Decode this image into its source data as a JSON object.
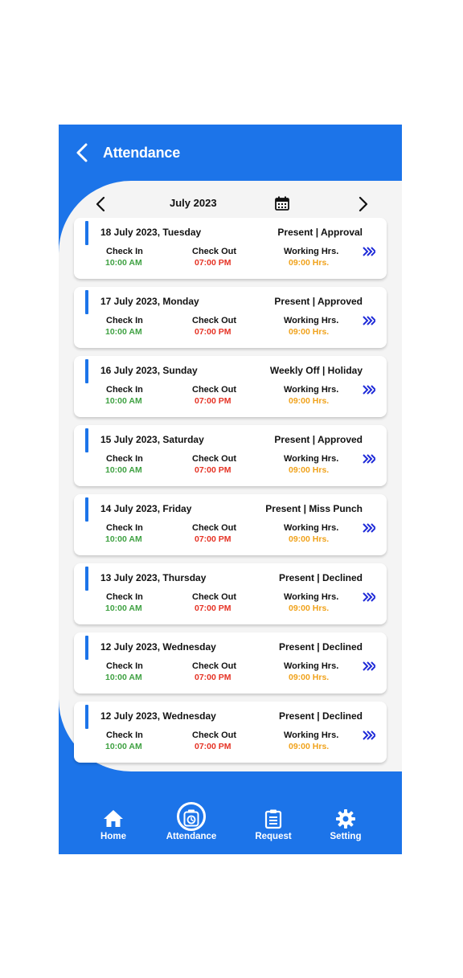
{
  "header": {
    "title": "Attendance"
  },
  "month_bar": {
    "label": "July 2023"
  },
  "columns": {
    "check_in": "Check In",
    "check_out": "Check Out",
    "working": "Working Hrs."
  },
  "records": [
    {
      "date": "18 July 2023, Tuesday",
      "status": "Present | Approval",
      "check_in": "10:00 AM",
      "check_out": "07:00 PM",
      "hours": "09:00 Hrs."
    },
    {
      "date": "17 July 2023, Monday",
      "status": "Present | Approved",
      "check_in": "10:00 AM",
      "check_out": "07:00 PM",
      "hours": "09:00 Hrs."
    },
    {
      "date": "16 July 2023, Sunday",
      "status": "Weekly Off | Holiday",
      "check_in": "10:00 AM",
      "check_out": "07:00 PM",
      "hours": "09:00 Hrs."
    },
    {
      "date": "15 July 2023, Saturday",
      "status": "Present | Approved",
      "check_in": "10:00 AM",
      "check_out": "07:00 PM",
      "hours": "09:00 Hrs."
    },
    {
      "date": "14 July 2023, Friday",
      "status": "Present | Miss Punch",
      "check_in": "10:00 AM",
      "check_out": "07:00 PM",
      "hours": "09:00 Hrs."
    },
    {
      "date": "13 July 2023, Thursday",
      "status": "Present | Declined",
      "check_in": "10:00 AM",
      "check_out": "07:00 PM",
      "hours": "09:00 Hrs."
    },
    {
      "date": "12 July 2023, Wednesday",
      "status": "Present | Declined",
      "check_in": "10:00 AM",
      "check_out": "07:00 PM",
      "hours": "09:00 Hrs."
    },
    {
      "date": "12 July 2023, Wednesday",
      "status": "Present | Declined",
      "check_in": "10:00 AM",
      "check_out": "07:00 PM",
      "hours": "09:00 Hrs."
    }
  ],
  "nav": {
    "home": "Home",
    "attendance": "Attendance",
    "request": "Request",
    "setting": "Setting"
  },
  "colors": {
    "primary": "#1c74e9",
    "check_in": "#3fa142",
    "check_out": "#e53224",
    "hours": "#f0a21b",
    "chevron": "#1f2bd8"
  }
}
